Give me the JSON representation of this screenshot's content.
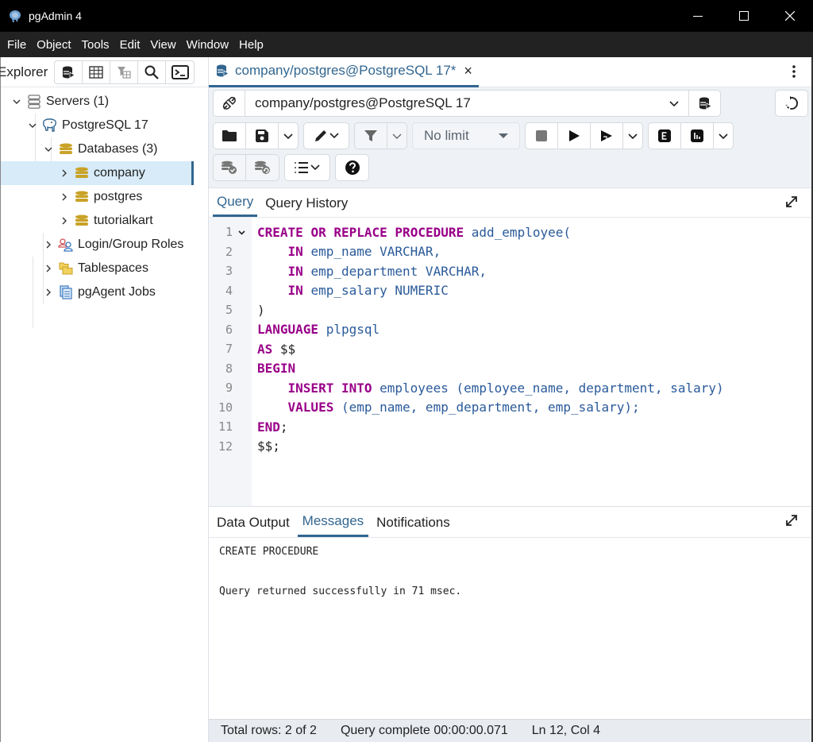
{
  "window": {
    "title": "pgAdmin 4",
    "controls": {
      "minimize": "minimize",
      "maximize": "maximize",
      "close": "close"
    }
  },
  "menu": [
    "File",
    "Object",
    "Tools",
    "Edit",
    "View",
    "Window",
    "Help"
  ],
  "explorer": {
    "title": "Explorer",
    "tools": [
      "query-tool-icon",
      "view-data-icon",
      "filtered-rows-icon",
      "search-objects-icon",
      "psql-tool-icon"
    ],
    "tree": [
      {
        "label": "Servers (1)",
        "icon": "servers-icon",
        "expanded": true,
        "level": 0
      },
      {
        "label": "PostgreSQL 17",
        "icon": "postgres-elephant-icon",
        "expanded": true,
        "level": 1
      },
      {
        "label": "Databases (3)",
        "icon": "databases-icon",
        "expanded": true,
        "level": 2
      },
      {
        "label": "company",
        "icon": "database-icon",
        "expanded": false,
        "level": 3,
        "selected": true
      },
      {
        "label": "postgres",
        "icon": "database-icon",
        "expanded": false,
        "level": 3
      },
      {
        "label": "tutorialkart",
        "icon": "database-icon",
        "expanded": false,
        "level": 3
      },
      {
        "label": "Login/Group Roles",
        "icon": "roles-icon",
        "expanded": false,
        "level": 2
      },
      {
        "label": "Tablespaces",
        "icon": "tablespaces-icon",
        "expanded": false,
        "level": 2
      },
      {
        "label": "pgAgent Jobs",
        "icon": "pgagent-jobs-icon",
        "expanded": false,
        "level": 2
      }
    ]
  },
  "editor_tab": {
    "label": "company/postgres@PostgreSQL 17*",
    "close": "×"
  },
  "connection": {
    "value": "company/postgres@PostgreSQL 17"
  },
  "toolbar": {
    "limit": "No limit"
  },
  "query_tabs": [
    {
      "label": "Query",
      "active": true
    },
    {
      "label": "Query History",
      "active": false
    }
  ],
  "code": [
    {
      "n": "1",
      "fold": true,
      "tokens": [
        [
          "kw",
          "CREATE"
        ],
        [
          "pl",
          " "
        ],
        [
          "kw",
          "OR"
        ],
        [
          "pl",
          " "
        ],
        [
          "kw",
          "REPLACE"
        ],
        [
          "pl",
          " "
        ],
        [
          "kw",
          "PROCEDURE"
        ],
        [
          "pl",
          " "
        ],
        [
          "id",
          "add_employee("
        ]
      ]
    },
    {
      "n": "2",
      "tokens": [
        [
          "pl",
          "    "
        ],
        [
          "kw",
          "IN"
        ],
        [
          "pl",
          " "
        ],
        [
          "id",
          "emp_name VARCHAR,"
        ]
      ]
    },
    {
      "n": "3",
      "tokens": [
        [
          "pl",
          "    "
        ],
        [
          "kw",
          "IN"
        ],
        [
          "pl",
          " "
        ],
        [
          "id",
          "emp_department VARCHAR,"
        ]
      ]
    },
    {
      "n": "4",
      "tokens": [
        [
          "pl",
          "    "
        ],
        [
          "kw",
          "IN"
        ],
        [
          "pl",
          " "
        ],
        [
          "id",
          "emp_salary NUMERIC"
        ]
      ]
    },
    {
      "n": "5",
      "tokens": [
        [
          "pl",
          ")"
        ]
      ]
    },
    {
      "n": "6",
      "tokens": [
        [
          "kw",
          "LANGUAGE"
        ],
        [
          "pl",
          " "
        ],
        [
          "id",
          "plpgsql"
        ]
      ]
    },
    {
      "n": "7",
      "tokens": [
        [
          "kw",
          "AS"
        ],
        [
          "pl",
          " $$"
        ]
      ]
    },
    {
      "n": "8",
      "tokens": [
        [
          "kw",
          "BEGIN"
        ]
      ]
    },
    {
      "n": "9",
      "tokens": [
        [
          "pl",
          "    "
        ],
        [
          "kw",
          "INSERT"
        ],
        [
          "pl",
          " "
        ],
        [
          "kw",
          "INTO"
        ],
        [
          "pl",
          " "
        ],
        [
          "id",
          "employees (employee_name, department, salary)"
        ]
      ]
    },
    {
      "n": "10",
      "tokens": [
        [
          "pl",
          "    "
        ],
        [
          "kw",
          "VALUES"
        ],
        [
          "pl",
          " "
        ],
        [
          "id",
          "(emp_name, emp_department, emp_salary);"
        ]
      ]
    },
    {
      "n": "11",
      "tokens": [
        [
          "kw",
          "END"
        ],
        [
          "pl",
          ";"
        ]
      ]
    },
    {
      "n": "12",
      "tokens": [
        [
          "pl",
          "$$;"
        ]
      ]
    }
  ],
  "output_tabs": [
    {
      "label": "Data Output",
      "active": false
    },
    {
      "label": "Messages",
      "active": true
    },
    {
      "label": "Notifications",
      "active": false
    }
  ],
  "messages": [
    "CREATE PROCEDURE",
    "",
    "Query returned successfully in 71 msec."
  ],
  "status": {
    "rows": "Total rows: 2 of 2",
    "query": "Query complete 00:00:00.071",
    "cursor": "Ln 12, Col 4"
  },
  "colors": {
    "accent": "#326690",
    "keyword": "#990088",
    "identifier": "#2a5a9a",
    "selected_row": "#d7ebf8",
    "db_icon": "#c9a227"
  }
}
